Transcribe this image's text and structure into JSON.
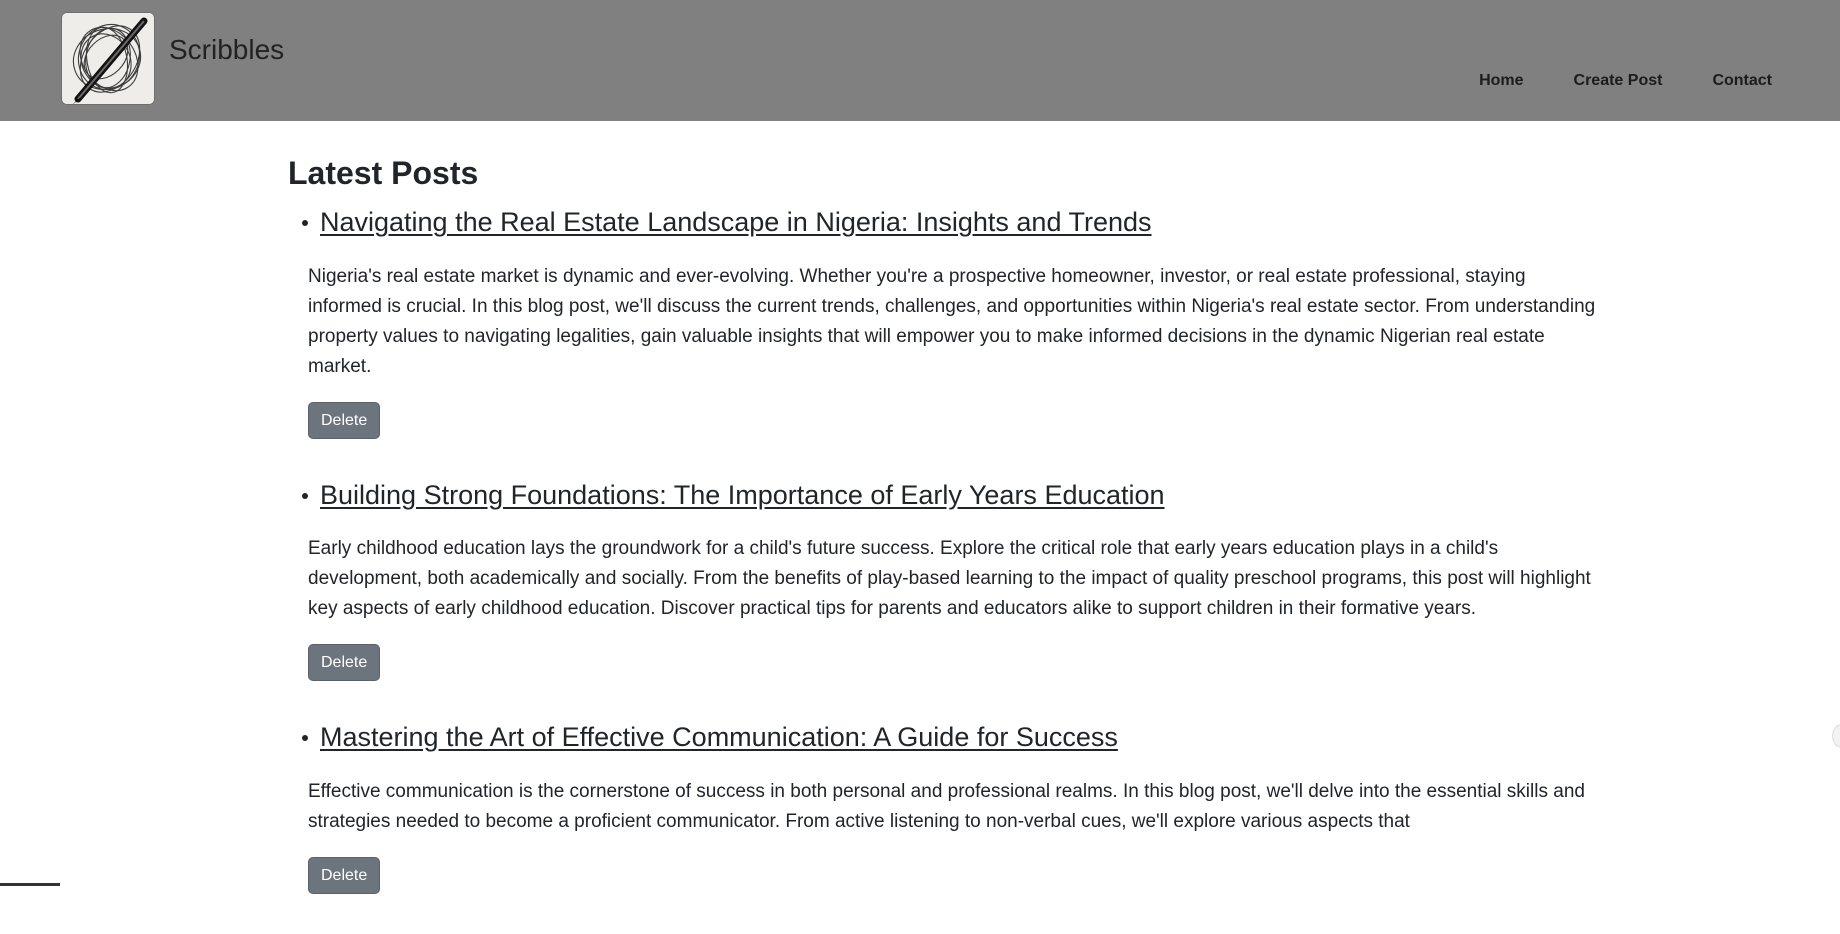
{
  "header": {
    "brand": "Scribbles",
    "nav": [
      {
        "label": "Home"
      },
      {
        "label": "Create Post"
      },
      {
        "label": "Contact"
      }
    ]
  },
  "main": {
    "title": "Latest Posts",
    "posts": [
      {
        "title": "Navigating the Real Estate Landscape in Nigeria: Insights and Trends",
        "body": "Nigeria's real estate market is dynamic and ever-evolving. Whether you're a prospective homeowner, investor, or real estate professional, staying informed is crucial. In this blog post, we'll discuss the current trends, challenges, and opportunities within Nigeria's real estate sector. From understanding property values to navigating legalities, gain valuable insights that will empower you to make informed decisions in the dynamic Nigerian real estate market.",
        "delete_label": "Delete"
      },
      {
        "title": "Building Strong Foundations: The Importance of Early Years Education",
        "body": "Early childhood education lays the groundwork for a child's future success. Explore the critical role that early years education plays in a child's development, both academically and socially. From the benefits of play-based learning to the impact of quality preschool programs, this post will highlight key aspects of early childhood education. Discover practical tips for parents and educators alike to support children in their formative years.",
        "delete_label": "Delete"
      },
      {
        "title": "Mastering the Art of Effective Communication: A Guide for Success",
        "body": "Effective communication is the cornerstone of success in both personal and professional realms. In this blog post, we'll delve into the essential skills and strategies needed to become a proficient communicator. From active listening to non-verbal cues, we'll explore various aspects that",
        "delete_label": "Delete"
      }
    ]
  },
  "colors": {
    "header_bg": "#808080",
    "button_bg": "#6c757d",
    "text": "#212529"
  }
}
